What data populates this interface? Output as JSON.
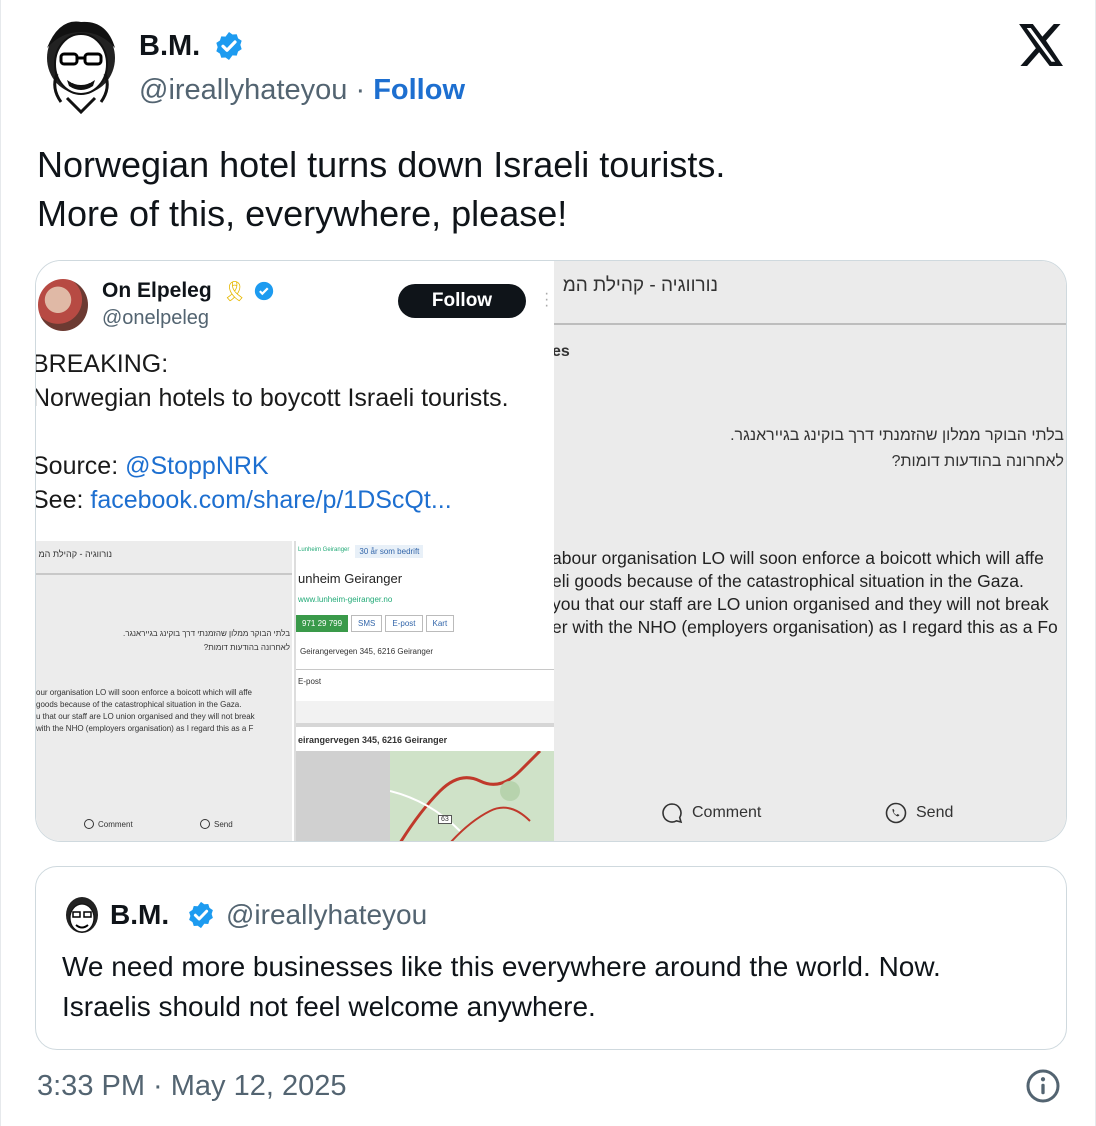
{
  "author": {
    "name": "B.M.",
    "handle": "@ireallyhateyou",
    "separator": "·",
    "follow_label": "Follow",
    "avatar_icon": "portrait-sketch-avatar",
    "verified_icon": "verified-badge-icon"
  },
  "platform_logo": "x-logo-icon",
  "tweet": {
    "line1": "Norwegian hotel turns down Israeli tourists.",
    "line2": "More of this, everywhere, please!"
  },
  "media": {
    "embedded_tweet": {
      "name": "On Elpeleg",
      "ribbon": "🎗",
      "handle": "@onelpeleg",
      "follow_label": "Follow",
      "lines": [
        "BREAKING:",
        "Norwegian hotels to boycott Israeli tourists.",
        "",
        "Source: ",
        "See: "
      ],
      "source_link": "@StoppNRK",
      "see_link": "facebook.com/share/p/1DScQt..."
    },
    "thumb1": {
      "heb_title": "נורווגיה - קהילת המ",
      "heb1": "בלתי הבוקר ממלון שהזמנתי דרך בוקינג בגייראנגר.",
      "heb2": "לאחרונה בהודעות דומות?",
      "eng": [
        "our organisation LO will soon enforce a boicott which will affe",
        " goods because of the catastrophical situation in the Gaza.",
        "u that our staff are LO union organised and they will not break",
        " with the NHO (employers organisation) as I regard this as a F"
      ],
      "comment": "Comment",
      "send": "Send"
    },
    "thumb2": {
      "tag1": "Lunheim Geiranger",
      "tag2": "30 år som bedrift",
      "title": "unheim Geiranger",
      "url": "www.lunheim-geiranger.no",
      "phone": "971 29 799",
      "sms": "SMS",
      "epost": "E-post",
      "kart": "Kart",
      "address": "Geirangervegen 345, 6216 Geiranger",
      "epost_label": "E-post",
      "map_address": "eirangervegen 345, 6216 Geiranger",
      "road_num": "63"
    },
    "right_panel": {
      "heb_title": "נורווגיה - קהילת המ",
      "es": "es",
      "heb1": "בלתי הבוקר ממלון שהזמנתי דרך בוקינג בגייראנגר.",
      "heb2": "לאחרונה בהודעות דומות?",
      "eng": [
        "abour organisation LO will soon enforce a boicott which will affe",
        "eli goods because of the catastrophical situation in the Gaza.",
        "you that our staff are LO union organised and they will not break",
        "er with the NHO (employers organisation) as I regard this as a Fo"
      ],
      "comment": "Comment",
      "send": "Send"
    }
  },
  "quote": {
    "name": "B.M.",
    "handle": "@ireallyhateyou",
    "line1": "We need more businesses like this everywhere around the world. Now.",
    "line2": "Israelis should not feel welcome anywhere."
  },
  "timestamp": "3:33 PM · May 12, 2025",
  "colors": {
    "accent": "#1d9bf0",
    "follow": "#1d6fd0",
    "muted": "#536471"
  }
}
